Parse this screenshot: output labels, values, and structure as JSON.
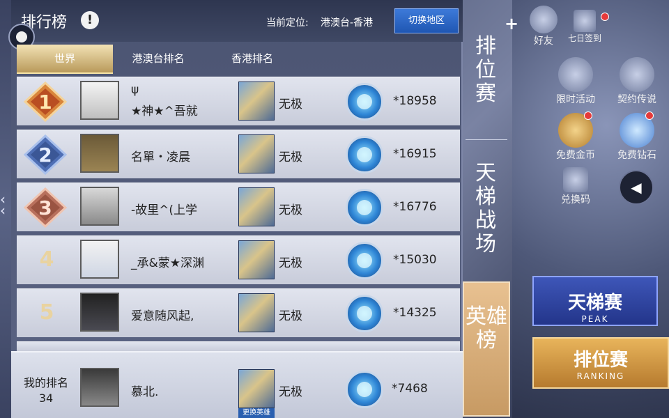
{
  "header": {
    "title": "排行榜",
    "info_icon": "!",
    "location_label": "当前定位:",
    "location_value": "港澳台-香港",
    "switch_button": "切换地区"
  },
  "tabs": [
    {
      "label": "世界",
      "active": true
    },
    {
      "label": "港澳台排名",
      "active": false
    },
    {
      "label": "香港排名",
      "active": false
    }
  ],
  "rows": [
    {
      "rank": "1",
      "name_line1": "ψ",
      "name_line2": "★神★^吾就",
      "hero": "无极",
      "score": "*18958"
    },
    {
      "rank": "2",
      "name_line1": "",
      "name_line2": "名單・凌晨",
      "hero": "无极",
      "score": "*16915"
    },
    {
      "rank": "3",
      "name_line1": "",
      "name_line2": "-故里^(上学",
      "hero": "无极",
      "score": "*16776"
    },
    {
      "rank": "4",
      "name_line1": "",
      "name_line2": "_承&蒙★深渊",
      "hero": "无极",
      "score": "*15030"
    },
    {
      "rank": "5",
      "name_line1": "",
      "name_line2": "爱意随风起,",
      "hero": "无极",
      "score": "*14325"
    }
  ],
  "my_rank": {
    "label": "我的排名",
    "rank": "34",
    "name": "慕北.",
    "hero": "无极",
    "change_hero": "更换英雄",
    "score": "*7468"
  },
  "side_tabs": {
    "ranked": "排位赛",
    "ladder": "天梯战场",
    "heroes": "英雄榜"
  },
  "game_icons": {
    "friends": "好友",
    "seven_day": "七日签到",
    "limited_event": "限时活动",
    "contract": "契约传说",
    "free_gold": "免费金币",
    "free_diamond": "免费钻石",
    "redeem": "兑换码"
  },
  "mode_buttons": {
    "ladder_title": "天梯赛",
    "ladder_sub": "PEAK",
    "ranked_title": "排位赛",
    "ranked_sub": "RANKING"
  },
  "colors": {
    "accent_gold": "#c79a63",
    "badge_1": "#d9853b",
    "badge_2": "#4f6fb5",
    "badge_3": "#b8705d",
    "switch_blue": "#1f56b2"
  }
}
